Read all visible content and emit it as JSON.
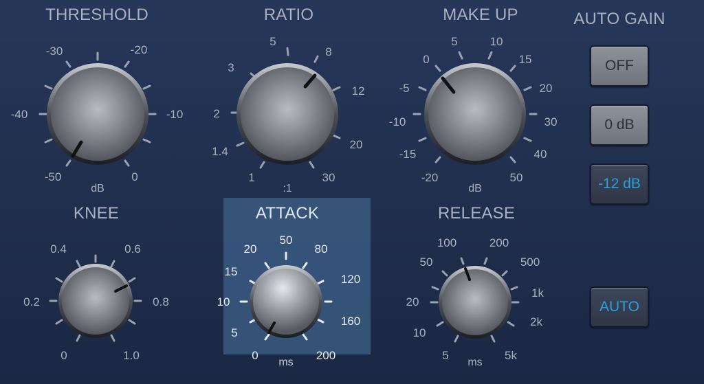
{
  "colors": {
    "label": "#a9b1c0",
    "attack_label": "#dfe6ef",
    "active_text": "#2aa0df"
  },
  "knobs": {
    "threshold": {
      "title": "THRESHOLD",
      "unit": "dB",
      "ticks": [
        "-30",
        "-20",
        "-40",
        "-10",
        "-50",
        "0"
      ]
    },
    "ratio": {
      "title": "RATIO",
      "unit": ":1",
      "ticks": [
        "5",
        "8",
        "3",
        "12",
        "2",
        "20",
        "1.4",
        "1",
        "30"
      ]
    },
    "makeup": {
      "title": "MAKE UP",
      "unit": "dB",
      "ticks": [
        "5",
        "10",
        "0",
        "15",
        "-5",
        "20",
        "-10",
        "30",
        "-15",
        "40",
        "-20",
        "50"
      ]
    },
    "knee": {
      "title": "KNEE",
      "ticks": [
        "0.4",
        "0.6",
        "0.2",
        "0.8",
        "0",
        "1.0"
      ]
    },
    "attack": {
      "title": "ATTACK",
      "unit": "ms",
      "ticks": [
        "50",
        "20",
        "80",
        "15",
        "120",
        "10",
        "160",
        "5",
        "0",
        "200"
      ]
    },
    "release": {
      "title": "RELEASE",
      "unit": "ms",
      "ticks": [
        "100",
        "200",
        "50",
        "500",
        "20",
        "1k",
        "10",
        "2k",
        "5",
        "5k"
      ]
    }
  },
  "auto_gain": {
    "title": "AUTO GAIN",
    "buttons": [
      "OFF",
      "0 dB",
      "-12 dB"
    ],
    "selected": "-12 dB",
    "auto_button": "AUTO"
  }
}
